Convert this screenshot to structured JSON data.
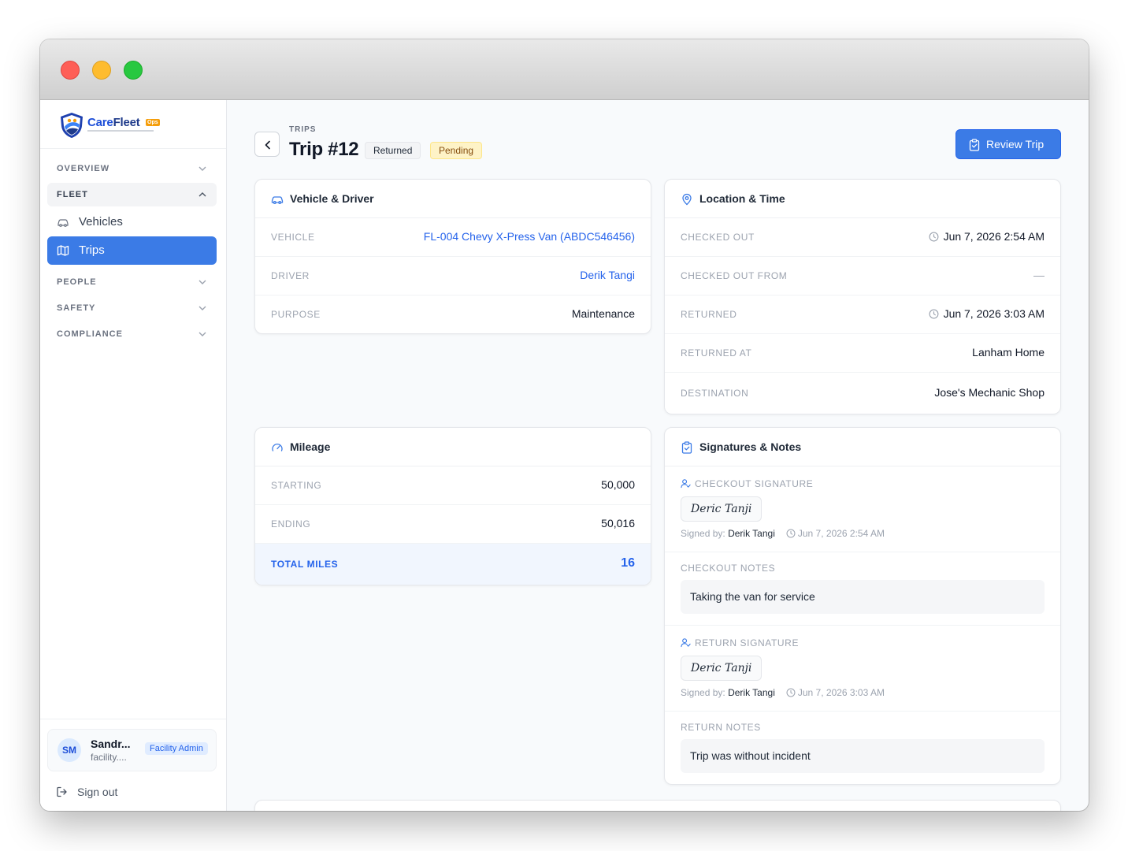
{
  "window": {
    "colors": {
      "close": "#fe5f57",
      "minimize": "#febc2e",
      "zoom": "#28c840"
    }
  },
  "brand": {
    "name_care": "Care",
    "name_fleet": "Fleet",
    "badge": "Ops",
    "accent": "#3b7be6"
  },
  "sidebar": {
    "sections": [
      {
        "label": "OVERVIEW",
        "open": false
      },
      {
        "label": "FLEET",
        "open": true
      },
      {
        "label": "PEOPLE",
        "open": false
      },
      {
        "label": "SAFETY",
        "open": false
      },
      {
        "label": "COMPLIANCE",
        "open": false
      }
    ],
    "items": [
      {
        "label": "Vehicles",
        "icon": "car-icon",
        "active": false
      },
      {
        "label": "Trips",
        "icon": "map-icon",
        "active": true
      }
    ],
    "user": {
      "initials": "SM",
      "name": "Sandr...",
      "email": "facility....",
      "role": "Facility Admin"
    },
    "sign_out": "Sign out"
  },
  "header": {
    "breadcrumb": "TRIPS",
    "title": "Trip #12",
    "badges": {
      "returned": "Returned",
      "pending": "Pending"
    },
    "review_button": "Review Trip"
  },
  "vehicle_driver": {
    "title": "Vehicle & Driver",
    "rows": [
      {
        "label": "VEHICLE",
        "value": "FL-004 Chevy X-Press Van (ABDC546456)"
      },
      {
        "label": "DRIVER",
        "value": "Derik Tangi"
      },
      {
        "label": "PURPOSE",
        "value": "Maintenance"
      }
    ]
  },
  "location_time": {
    "title": "Location & Time",
    "rows": [
      {
        "label": "CHECKED OUT",
        "value": "Jun 7, 2026 2:54 AM"
      },
      {
        "label": "CHECKED OUT FROM",
        "value": "—"
      },
      {
        "label": "RETURNED",
        "value": "Jun 7, 2026 3:03 AM"
      },
      {
        "label": "RETURNED AT",
        "value": "Lanham Home"
      },
      {
        "label": "DESTINATION",
        "value": "Jose's Mechanic Shop"
      }
    ]
  },
  "mileage": {
    "title": "Mileage",
    "rows": [
      {
        "label": "STARTING",
        "value": "50,000"
      },
      {
        "label": "ENDING",
        "value": "50,016"
      },
      {
        "label": "TOTAL MILES",
        "value": "16"
      }
    ]
  },
  "signatures": {
    "title": "Signatures & Notes",
    "signed_by_label": "Signed by:",
    "checkout_signature": {
      "label": "CHECKOUT SIGNATURE",
      "signature": "Deric Tanji",
      "signer": "Derik Tangi",
      "time": "Jun 7, 2026 2:54 AM"
    },
    "checkout_notes": {
      "label": "CHECKOUT NOTES",
      "text": "Taking the van for service"
    },
    "return_signature": {
      "label": "RETURN SIGNATURE",
      "signature": "Deric Tanji",
      "signer": "Derik Tangi",
      "time": "Jun 7, 2026 3:03 AM"
    },
    "return_notes": {
      "label": "RETURN NOTES",
      "text": "Trip was without incident"
    }
  }
}
